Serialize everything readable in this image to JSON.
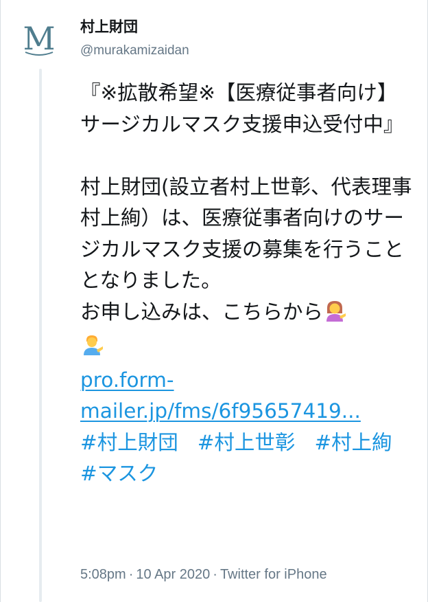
{
  "user": {
    "display_name": "村上財団",
    "handle": "@murakamizaidan",
    "avatar_letter": "M",
    "avatar_color": "#4f7d8e"
  },
  "tweet": {
    "title_line": "『※拡散希望※【医療従事者向け】サージカルマスク支援申込受付中』",
    "paragraph": "村上財団(設立者村上世彰、代表理事村上絢）は、医療従事者向けのサージカルマスク支援の募集を行うこととなりました。",
    "cta_text": "お申し込みは、こちらから",
    "emoji_1": "woman-tipping-hand-icon",
    "emoji_2": "man-tipping-hand-icon",
    "link_line1": "pro.form-",
    "link_line2": "mailer.jp/fms/6f95657419...",
    "hashtags": [
      "#村上財団",
      "#村上世彰",
      "#村上絢",
      "#マスク"
    ],
    "link_color": "#1b95e0"
  },
  "meta": {
    "time": "5:08pm",
    "date": "10 Apr 2020",
    "source": "Twitter for iPhone",
    "separator": "·"
  }
}
